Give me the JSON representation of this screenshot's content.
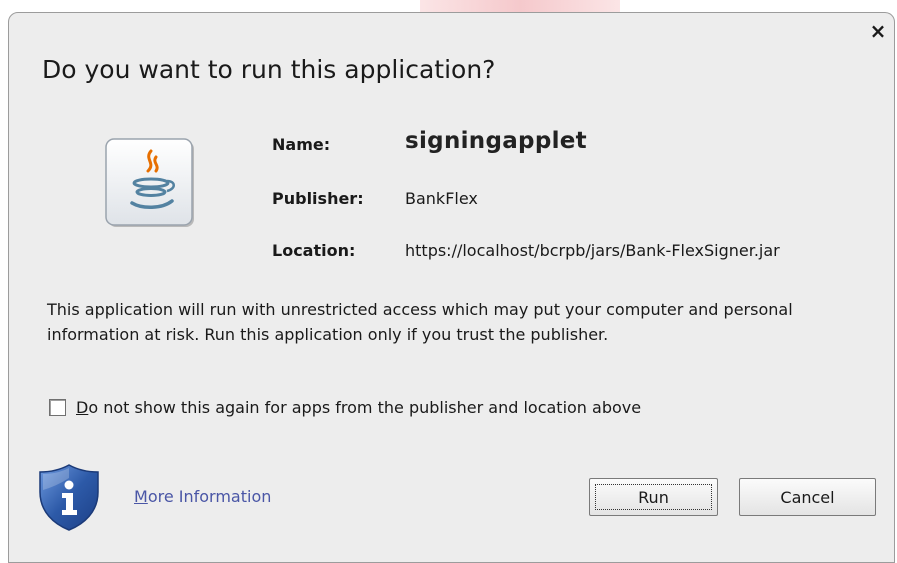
{
  "dialog": {
    "title": "Do you want to run this application?",
    "close_glyph": "×"
  },
  "app_info": {
    "name_label": "Name:",
    "name_value": "signingapplet",
    "publisher_label": "Publisher:",
    "publisher_value": "BankFlex",
    "location_label": "Location:",
    "location_value": "https://localhost/bcrpb/jars/Bank-FlexSigner.jar"
  },
  "warning_text": "This application will run with unrestricted access which may put your computer and personal information at risk. Run this application only if you trust the publisher.",
  "checkbox": {
    "mnemonic": "D",
    "label_rest": "o not show this again for apps from the publisher and location above",
    "checked": false
  },
  "footer": {
    "more_info_mnemonic": "M",
    "more_info_rest": "ore Information",
    "run_label": "Run",
    "cancel_label": "Cancel"
  },
  "icons": {
    "app_icon": "java-icon",
    "info_icon": "shield-info-icon",
    "close_icon": "close-icon"
  },
  "colors": {
    "dialog_bg": "#ededed",
    "link": "#4a56a6",
    "shield_blue": "#2d5aa8"
  }
}
